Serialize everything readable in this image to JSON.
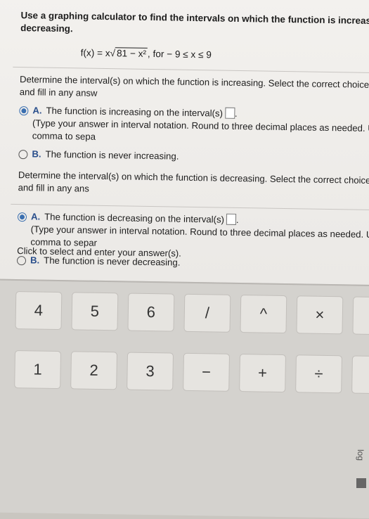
{
  "prompt": "Use a graphing calculator to find the intervals on which the function is increasing or decreasing.",
  "formula": {
    "prefix": "f(x) = x",
    "radical": "81 − x²",
    "suffix": ", for  − 9 ≤ x ≤ 9"
  },
  "increasing": {
    "instruction": "Determine the interval(s) on which the function is increasing. Select the correct choice below and fill in any answ",
    "choice_a_letter": "A.",
    "choice_a_text": "The function is increasing on the interval(s)",
    "choice_a_sub": "(Type your answer in interval notation. Round to three decimal places as needed. Use a comma to sepa",
    "choice_b_letter": "B.",
    "choice_b_text": "The function is never increasing.",
    "selected": "A"
  },
  "decreasing": {
    "instruction": "Determine the interval(s) on which the function is decreasing. Select the correct choice below and fill in any ans",
    "choice_a_letter": "A.",
    "choice_a_text": "The function is decreasing on the interval(s)",
    "choice_a_sub": "(Type your answer in interval notation. Round to three decimal places as needed. Use a comma to separ",
    "choice_b_letter": "B.",
    "choice_b_text": "The function is never decreasing.",
    "selected": "A"
  },
  "hint": "Click to select and enter your answer(s).",
  "keypad": {
    "row1": [
      "4",
      "5",
      "6",
      "/",
      "^",
      "×",
      ">"
    ],
    "row2": [
      "1",
      "2",
      "3",
      "−",
      "+",
      "÷",
      "<"
    ],
    "log_label": "log"
  },
  "colors": {
    "accent": "#3a6fb0",
    "background": "#ebe9e6",
    "text": "#1d1d1d"
  }
}
